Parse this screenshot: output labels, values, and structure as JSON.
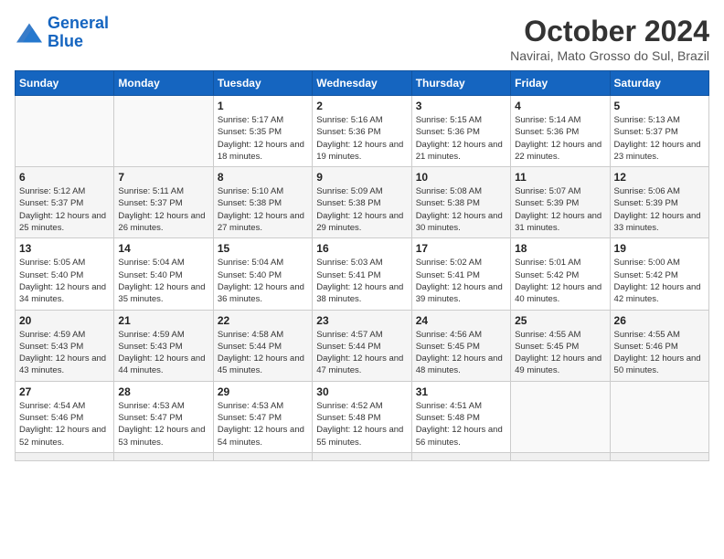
{
  "header": {
    "logo_line1": "General",
    "logo_line2": "Blue",
    "month": "October 2024",
    "location": "Navirai, Mato Grosso do Sul, Brazil"
  },
  "weekdays": [
    "Sunday",
    "Monday",
    "Tuesday",
    "Wednesday",
    "Thursday",
    "Friday",
    "Saturday"
  ],
  "days": [
    {
      "num": "",
      "data": ""
    },
    {
      "num": "",
      "data": ""
    },
    {
      "num": "1",
      "data": "Sunrise: 5:17 AM\nSunset: 5:35 PM\nDaylight: 12 hours and 18 minutes."
    },
    {
      "num": "2",
      "data": "Sunrise: 5:16 AM\nSunset: 5:36 PM\nDaylight: 12 hours and 19 minutes."
    },
    {
      "num": "3",
      "data": "Sunrise: 5:15 AM\nSunset: 5:36 PM\nDaylight: 12 hours and 21 minutes."
    },
    {
      "num": "4",
      "data": "Sunrise: 5:14 AM\nSunset: 5:36 PM\nDaylight: 12 hours and 22 minutes."
    },
    {
      "num": "5",
      "data": "Sunrise: 5:13 AM\nSunset: 5:37 PM\nDaylight: 12 hours and 23 minutes."
    },
    {
      "num": "6",
      "data": "Sunrise: 5:12 AM\nSunset: 5:37 PM\nDaylight: 12 hours and 25 minutes."
    },
    {
      "num": "7",
      "data": "Sunrise: 5:11 AM\nSunset: 5:37 PM\nDaylight: 12 hours and 26 minutes."
    },
    {
      "num": "8",
      "data": "Sunrise: 5:10 AM\nSunset: 5:38 PM\nDaylight: 12 hours and 27 minutes."
    },
    {
      "num": "9",
      "data": "Sunrise: 5:09 AM\nSunset: 5:38 PM\nDaylight: 12 hours and 29 minutes."
    },
    {
      "num": "10",
      "data": "Sunrise: 5:08 AM\nSunset: 5:38 PM\nDaylight: 12 hours and 30 minutes."
    },
    {
      "num": "11",
      "data": "Sunrise: 5:07 AM\nSunset: 5:39 PM\nDaylight: 12 hours and 31 minutes."
    },
    {
      "num": "12",
      "data": "Sunrise: 5:06 AM\nSunset: 5:39 PM\nDaylight: 12 hours and 33 minutes."
    },
    {
      "num": "13",
      "data": "Sunrise: 5:05 AM\nSunset: 5:40 PM\nDaylight: 12 hours and 34 minutes."
    },
    {
      "num": "14",
      "data": "Sunrise: 5:04 AM\nSunset: 5:40 PM\nDaylight: 12 hours and 35 minutes."
    },
    {
      "num": "15",
      "data": "Sunrise: 5:04 AM\nSunset: 5:40 PM\nDaylight: 12 hours and 36 minutes."
    },
    {
      "num": "16",
      "data": "Sunrise: 5:03 AM\nSunset: 5:41 PM\nDaylight: 12 hours and 38 minutes."
    },
    {
      "num": "17",
      "data": "Sunrise: 5:02 AM\nSunset: 5:41 PM\nDaylight: 12 hours and 39 minutes."
    },
    {
      "num": "18",
      "data": "Sunrise: 5:01 AM\nSunset: 5:42 PM\nDaylight: 12 hours and 40 minutes."
    },
    {
      "num": "19",
      "data": "Sunrise: 5:00 AM\nSunset: 5:42 PM\nDaylight: 12 hours and 42 minutes."
    },
    {
      "num": "20",
      "data": "Sunrise: 4:59 AM\nSunset: 5:43 PM\nDaylight: 12 hours and 43 minutes."
    },
    {
      "num": "21",
      "data": "Sunrise: 4:59 AM\nSunset: 5:43 PM\nDaylight: 12 hours and 44 minutes."
    },
    {
      "num": "22",
      "data": "Sunrise: 4:58 AM\nSunset: 5:44 PM\nDaylight: 12 hours and 45 minutes."
    },
    {
      "num": "23",
      "data": "Sunrise: 4:57 AM\nSunset: 5:44 PM\nDaylight: 12 hours and 47 minutes."
    },
    {
      "num": "24",
      "data": "Sunrise: 4:56 AM\nSunset: 5:45 PM\nDaylight: 12 hours and 48 minutes."
    },
    {
      "num": "25",
      "data": "Sunrise: 4:55 AM\nSunset: 5:45 PM\nDaylight: 12 hours and 49 minutes."
    },
    {
      "num": "26",
      "data": "Sunrise: 4:55 AM\nSunset: 5:46 PM\nDaylight: 12 hours and 50 minutes."
    },
    {
      "num": "27",
      "data": "Sunrise: 4:54 AM\nSunset: 5:46 PM\nDaylight: 12 hours and 52 minutes."
    },
    {
      "num": "28",
      "data": "Sunrise: 4:53 AM\nSunset: 5:47 PM\nDaylight: 12 hours and 53 minutes."
    },
    {
      "num": "29",
      "data": "Sunrise: 4:53 AM\nSunset: 5:47 PM\nDaylight: 12 hours and 54 minutes."
    },
    {
      "num": "30",
      "data": "Sunrise: 4:52 AM\nSunset: 5:48 PM\nDaylight: 12 hours and 55 minutes."
    },
    {
      "num": "31",
      "data": "Sunrise: 4:51 AM\nSunset: 5:48 PM\nDaylight: 12 hours and 56 minutes."
    },
    {
      "num": "",
      "data": ""
    },
    {
      "num": "",
      "data": ""
    },
    {
      "num": "",
      "data": ""
    }
  ]
}
